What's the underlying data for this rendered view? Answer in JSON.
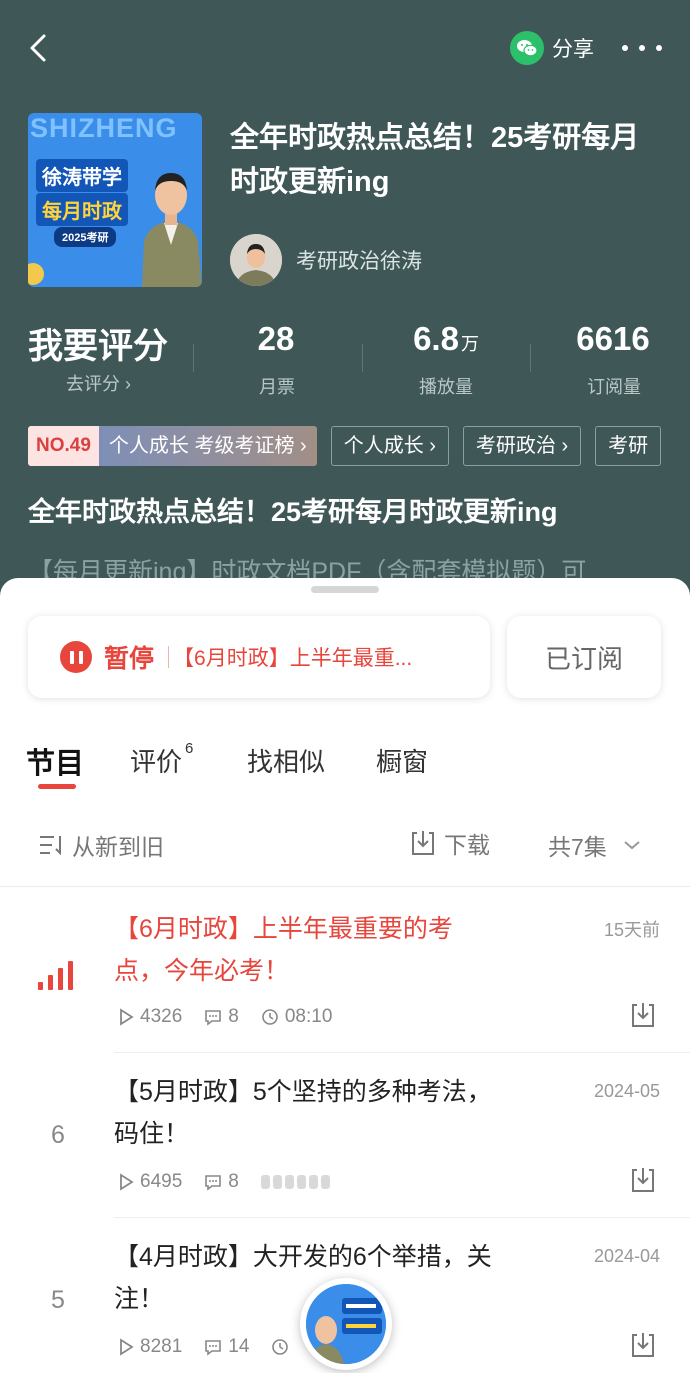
{
  "header": {
    "share_label": "分享"
  },
  "album": {
    "cover_brand": "SHIZHENG",
    "cover_line1": "徐涛带学",
    "cover_line2": "每月时政",
    "cover_line3": "2025考研",
    "title": "全年时政热点总结！25考研每月时政更新ing",
    "author": "考研政治徐涛"
  },
  "stats": {
    "rate_label": "我要评分",
    "rate_sub": "去评分 ›",
    "items": [
      {
        "value": "28",
        "unit": "",
        "label": "月票"
      },
      {
        "value": "6.8",
        "unit": "万",
        "label": "播放量"
      },
      {
        "value": "6616",
        "unit": "",
        "label": "订阅量"
      }
    ]
  },
  "tags": {
    "rank_no": "NO.49",
    "rank_name": "个人成长 考级考证榜 ›",
    "items": [
      "个人成长 ›",
      "考研政治 ›",
      "考研"
    ]
  },
  "description": {
    "title": "全年时政热点总结！25考研每月时政更新ing",
    "text": "【每月更新ing】时政文档PDF（含配套模拟题）可"
  },
  "player_card": {
    "pause_label": "暂停",
    "now_playing": "【6月时政】上半年最重...",
    "subscribed_label": "已订阅"
  },
  "tabs": [
    {
      "label": "节目",
      "badge": ""
    },
    {
      "label": "评价",
      "badge": "6"
    },
    {
      "label": "找相似",
      "badge": ""
    },
    {
      "label": "橱窗",
      "badge": ""
    }
  ],
  "toolbar": {
    "sort_label": "从新到旧",
    "download_label": "下载",
    "count_label": "共7集"
  },
  "episodes": [
    {
      "index": "",
      "title": "【6月时政】上半年最重要的考点，今年必考！",
      "date": "15天前",
      "plays": "4326",
      "comments": "8",
      "duration": "08:10",
      "playing": true
    },
    {
      "index": "6",
      "title": "【5月时政】5个坚持的多种考法，码住！",
      "date": "2024-05",
      "plays": "6495",
      "comments": "8",
      "duration": "",
      "playing": false
    },
    {
      "index": "5",
      "title": "【4月时政】大开发的6个举措，关注！",
      "date": "2024-04",
      "plays": "8281",
      "comments": "14",
      "duration": "",
      "playing": false
    }
  ],
  "colors": {
    "header_bg": "#3f5757",
    "accent": "#e8453c",
    "wechat": "#2dc06b"
  }
}
